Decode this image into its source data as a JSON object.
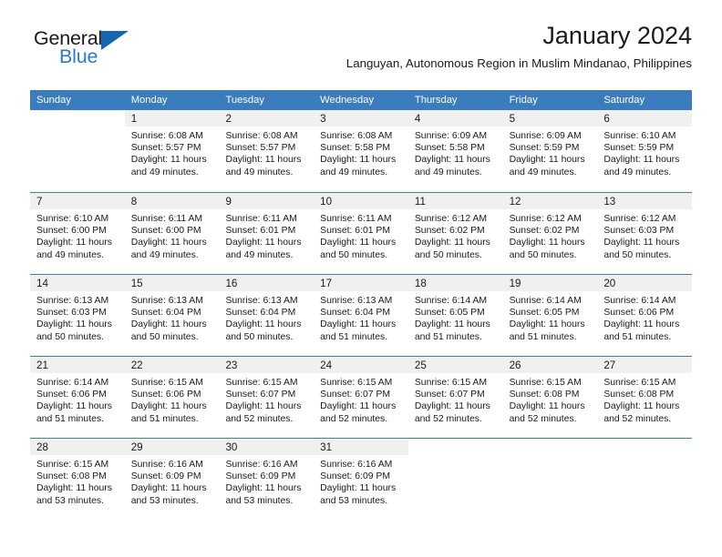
{
  "brand": {
    "name_part1": "General",
    "name_part2": "Blue",
    "triangle_color": "#1565b0",
    "blue_text_color": "#2a7cc7"
  },
  "header": {
    "title": "January 2024",
    "subtitle": "Languyan, Autonomous Region in Muslim Mindanao, Philippines"
  },
  "calendar": {
    "header_bg": "#3a7cbe",
    "daynum_bg": "#f0f0f0",
    "day_names": [
      "Sunday",
      "Monday",
      "Tuesday",
      "Wednesday",
      "Thursday",
      "Friday",
      "Saturday"
    ],
    "weeks": [
      [
        {
          "day": "",
          "sunrise": "",
          "sunset": "",
          "daylight_line1": "",
          "daylight_line2": ""
        },
        {
          "day": "1",
          "sunrise": "Sunrise: 6:08 AM",
          "sunset": "Sunset: 5:57 PM",
          "daylight_line1": "Daylight: 11 hours",
          "daylight_line2": "and 49 minutes."
        },
        {
          "day": "2",
          "sunrise": "Sunrise: 6:08 AM",
          "sunset": "Sunset: 5:57 PM",
          "daylight_line1": "Daylight: 11 hours",
          "daylight_line2": "and 49 minutes."
        },
        {
          "day": "3",
          "sunrise": "Sunrise: 6:08 AM",
          "sunset": "Sunset: 5:58 PM",
          "daylight_line1": "Daylight: 11 hours",
          "daylight_line2": "and 49 minutes."
        },
        {
          "day": "4",
          "sunrise": "Sunrise: 6:09 AM",
          "sunset": "Sunset: 5:58 PM",
          "daylight_line1": "Daylight: 11 hours",
          "daylight_line2": "and 49 minutes."
        },
        {
          "day": "5",
          "sunrise": "Sunrise: 6:09 AM",
          "sunset": "Sunset: 5:59 PM",
          "daylight_line1": "Daylight: 11 hours",
          "daylight_line2": "and 49 minutes."
        },
        {
          "day": "6",
          "sunrise": "Sunrise: 6:10 AM",
          "sunset": "Sunset: 5:59 PM",
          "daylight_line1": "Daylight: 11 hours",
          "daylight_line2": "and 49 minutes."
        }
      ],
      [
        {
          "day": "7",
          "sunrise": "Sunrise: 6:10 AM",
          "sunset": "Sunset: 6:00 PM",
          "daylight_line1": "Daylight: 11 hours",
          "daylight_line2": "and 49 minutes."
        },
        {
          "day": "8",
          "sunrise": "Sunrise: 6:11 AM",
          "sunset": "Sunset: 6:00 PM",
          "daylight_line1": "Daylight: 11 hours",
          "daylight_line2": "and 49 minutes."
        },
        {
          "day": "9",
          "sunrise": "Sunrise: 6:11 AM",
          "sunset": "Sunset: 6:01 PM",
          "daylight_line1": "Daylight: 11 hours",
          "daylight_line2": "and 49 minutes."
        },
        {
          "day": "10",
          "sunrise": "Sunrise: 6:11 AM",
          "sunset": "Sunset: 6:01 PM",
          "daylight_line1": "Daylight: 11 hours",
          "daylight_line2": "and 50 minutes."
        },
        {
          "day": "11",
          "sunrise": "Sunrise: 6:12 AM",
          "sunset": "Sunset: 6:02 PM",
          "daylight_line1": "Daylight: 11 hours",
          "daylight_line2": "and 50 minutes."
        },
        {
          "day": "12",
          "sunrise": "Sunrise: 6:12 AM",
          "sunset": "Sunset: 6:02 PM",
          "daylight_line1": "Daylight: 11 hours",
          "daylight_line2": "and 50 minutes."
        },
        {
          "day": "13",
          "sunrise": "Sunrise: 6:12 AM",
          "sunset": "Sunset: 6:03 PM",
          "daylight_line1": "Daylight: 11 hours",
          "daylight_line2": "and 50 minutes."
        }
      ],
      [
        {
          "day": "14",
          "sunrise": "Sunrise: 6:13 AM",
          "sunset": "Sunset: 6:03 PM",
          "daylight_line1": "Daylight: 11 hours",
          "daylight_line2": "and 50 minutes."
        },
        {
          "day": "15",
          "sunrise": "Sunrise: 6:13 AM",
          "sunset": "Sunset: 6:04 PM",
          "daylight_line1": "Daylight: 11 hours",
          "daylight_line2": "and 50 minutes."
        },
        {
          "day": "16",
          "sunrise": "Sunrise: 6:13 AM",
          "sunset": "Sunset: 6:04 PM",
          "daylight_line1": "Daylight: 11 hours",
          "daylight_line2": "and 50 minutes."
        },
        {
          "day": "17",
          "sunrise": "Sunrise: 6:13 AM",
          "sunset": "Sunset: 6:04 PM",
          "daylight_line1": "Daylight: 11 hours",
          "daylight_line2": "and 51 minutes."
        },
        {
          "day": "18",
          "sunrise": "Sunrise: 6:14 AM",
          "sunset": "Sunset: 6:05 PM",
          "daylight_line1": "Daylight: 11 hours",
          "daylight_line2": "and 51 minutes."
        },
        {
          "day": "19",
          "sunrise": "Sunrise: 6:14 AM",
          "sunset": "Sunset: 6:05 PM",
          "daylight_line1": "Daylight: 11 hours",
          "daylight_line2": "and 51 minutes."
        },
        {
          "day": "20",
          "sunrise": "Sunrise: 6:14 AM",
          "sunset": "Sunset: 6:06 PM",
          "daylight_line1": "Daylight: 11 hours",
          "daylight_line2": "and 51 minutes."
        }
      ],
      [
        {
          "day": "21",
          "sunrise": "Sunrise: 6:14 AM",
          "sunset": "Sunset: 6:06 PM",
          "daylight_line1": "Daylight: 11 hours",
          "daylight_line2": "and 51 minutes."
        },
        {
          "day": "22",
          "sunrise": "Sunrise: 6:15 AM",
          "sunset": "Sunset: 6:06 PM",
          "daylight_line1": "Daylight: 11 hours",
          "daylight_line2": "and 51 minutes."
        },
        {
          "day": "23",
          "sunrise": "Sunrise: 6:15 AM",
          "sunset": "Sunset: 6:07 PM",
          "daylight_line1": "Daylight: 11 hours",
          "daylight_line2": "and 52 minutes."
        },
        {
          "day": "24",
          "sunrise": "Sunrise: 6:15 AM",
          "sunset": "Sunset: 6:07 PM",
          "daylight_line1": "Daylight: 11 hours",
          "daylight_line2": "and 52 minutes."
        },
        {
          "day": "25",
          "sunrise": "Sunrise: 6:15 AM",
          "sunset": "Sunset: 6:07 PM",
          "daylight_line1": "Daylight: 11 hours",
          "daylight_line2": "and 52 minutes."
        },
        {
          "day": "26",
          "sunrise": "Sunrise: 6:15 AM",
          "sunset": "Sunset: 6:08 PM",
          "daylight_line1": "Daylight: 11 hours",
          "daylight_line2": "and 52 minutes."
        },
        {
          "day": "27",
          "sunrise": "Sunrise: 6:15 AM",
          "sunset": "Sunset: 6:08 PM",
          "daylight_line1": "Daylight: 11 hours",
          "daylight_line2": "and 52 minutes."
        }
      ],
      [
        {
          "day": "28",
          "sunrise": "Sunrise: 6:15 AM",
          "sunset": "Sunset: 6:08 PM",
          "daylight_line1": "Daylight: 11 hours",
          "daylight_line2": "and 53 minutes."
        },
        {
          "day": "29",
          "sunrise": "Sunrise: 6:16 AM",
          "sunset": "Sunset: 6:09 PM",
          "daylight_line1": "Daylight: 11 hours",
          "daylight_line2": "and 53 minutes."
        },
        {
          "day": "30",
          "sunrise": "Sunrise: 6:16 AM",
          "sunset": "Sunset: 6:09 PM",
          "daylight_line1": "Daylight: 11 hours",
          "daylight_line2": "and 53 minutes."
        },
        {
          "day": "31",
          "sunrise": "Sunrise: 6:16 AM",
          "sunset": "Sunset: 6:09 PM",
          "daylight_line1": "Daylight: 11 hours",
          "daylight_line2": "and 53 minutes."
        },
        {
          "day": "",
          "sunrise": "",
          "sunset": "",
          "daylight_line1": "",
          "daylight_line2": ""
        },
        {
          "day": "",
          "sunrise": "",
          "sunset": "",
          "daylight_line1": "",
          "daylight_line2": ""
        },
        {
          "day": "",
          "sunrise": "",
          "sunset": "",
          "daylight_line1": "",
          "daylight_line2": ""
        }
      ]
    ]
  }
}
